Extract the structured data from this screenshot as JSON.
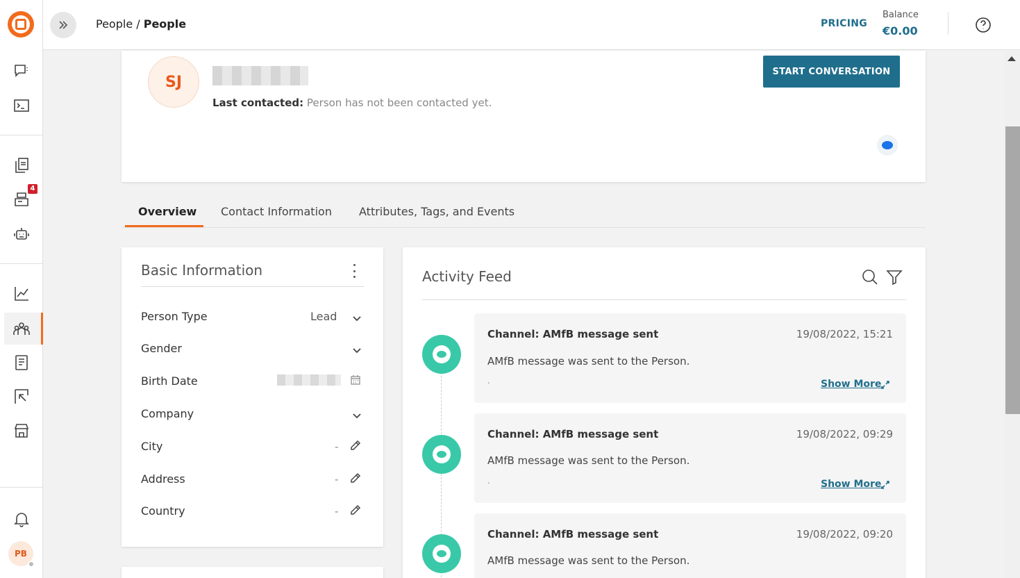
{
  "header": {
    "breadcrumb_parent": "People",
    "breadcrumb_separator": " / ",
    "breadcrumb_current": "People",
    "pricing_label": "PRICING",
    "balance_label": "Balance",
    "balance_value": "€0.00"
  },
  "sidebar": {
    "badge_count": "4",
    "user_initials": "PB",
    "active_item": "people-icon",
    "icons": [
      "chat-icon",
      "terminal-icon",
      "documents-icon",
      "inbox-icon",
      "bot-icon",
      "analytics-icon",
      "people-icon",
      "book-icon",
      "flow-icon",
      "store-icon",
      "bell-icon"
    ]
  },
  "profile": {
    "initials": "SJ",
    "last_contacted_label": "Last contacted:",
    "last_contacted_value": " Person has not been contacted yet.",
    "start_button": "START CONVERSATION"
  },
  "tabs": [
    {
      "label": "Overview",
      "active": true
    },
    {
      "label": "Contact Information",
      "active": false
    },
    {
      "label": "Attributes, Tags, and Events",
      "active": false
    }
  ],
  "basic_info": {
    "title": "Basic Information",
    "fields": [
      {
        "label": "Person Type",
        "value": "Lead"
      },
      {
        "label": "Gender",
        "value": ""
      },
      {
        "label": "Birth Date",
        "value": ""
      },
      {
        "label": "Company",
        "value": ""
      },
      {
        "label": "City",
        "value": "-"
      },
      {
        "label": "Address",
        "value": "-"
      },
      {
        "label": "Country",
        "value": "-"
      }
    ]
  },
  "activity_feed": {
    "title": "Activity Feed",
    "events": [
      {
        "title": "Channel: AMfB message sent",
        "date": "19/08/2022, 15:21",
        "description": "AMfB message was sent to the Person.",
        "dot": ".",
        "show_more": "Show More"
      },
      {
        "title": "Channel: AMfB message sent",
        "date": "19/08/2022, 09:29",
        "description": "AMfB message was sent to the Person.",
        "dot": ".",
        "show_more": "Show More"
      },
      {
        "title": "Channel: AMfB message sent",
        "date": "19/08/2022, 09:20",
        "description": "AMfB message was sent to the Person.",
        "dot": "",
        "show_more": ""
      }
    ]
  },
  "colors": {
    "accent": "#f26b1d",
    "primary": "#1f6e8c",
    "event": "#3ac9a8",
    "badge": "#d0202c"
  }
}
